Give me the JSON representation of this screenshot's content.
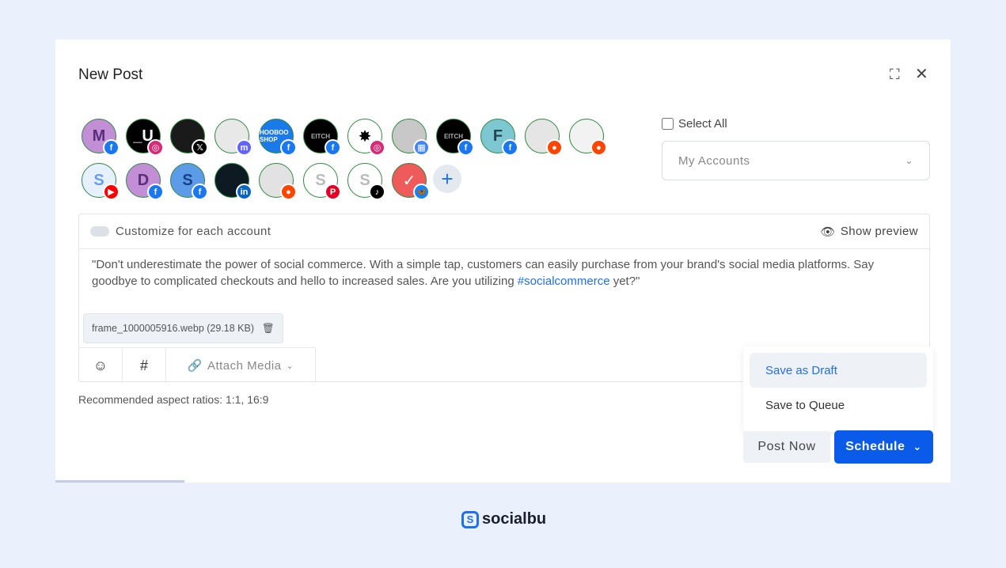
{
  "modal": {
    "title": "New Post"
  },
  "accounts": [
    {
      "label": "M",
      "bg": "#c28fd6",
      "fg": "#5a2e7a",
      "network": "facebook"
    },
    {
      "label": "_U",
      "bg": "#000000",
      "fg": "#ffffff",
      "network": "instagram"
    },
    {
      "label": "",
      "bg": "#1a1a1a",
      "fg": "#fff",
      "network": "x"
    },
    {
      "label": "",
      "bg": "#e8e8e8",
      "fg": "#333",
      "network": "mastodon"
    },
    {
      "label": "HOOBOO SHOP",
      "bg": "#1a7ae8",
      "fg": "#ffffff",
      "network": "facebook"
    },
    {
      "label": "EITCH",
      "bg": "#000000",
      "fg": "#aaaaaa",
      "network": "facebook"
    },
    {
      "label": "✸",
      "bg": "#ffffff",
      "fg": "#000",
      "network": "instagram"
    },
    {
      "label": "",
      "bg": "#c8c8c8",
      "fg": "#fff",
      "network": "google-business"
    },
    {
      "label": "EITCH",
      "bg": "#000000",
      "fg": "#aaaaaa",
      "network": "facebook"
    },
    {
      "label": "F",
      "bg": "#7cc7d1",
      "fg": "#245",
      "network": "facebook"
    },
    {
      "label": "",
      "bg": "#e5e5e5",
      "fg": "#fff",
      "network": "reddit"
    },
    {
      "label": "",
      "bg": "#f2f2f2",
      "fg": "#999",
      "network": "reddit"
    },
    {
      "label": "S",
      "bg": "#e6f0ff",
      "fg": "#6a9cf0",
      "network": "youtube"
    },
    {
      "label": "D",
      "bg": "#c28fd6",
      "fg": "#5a2e7a",
      "network": "facebook"
    },
    {
      "label": "S",
      "bg": "#5b9be8",
      "fg": "#1a3f8a",
      "network": "facebook"
    },
    {
      "label": "",
      "bg": "#0d1a22",
      "fg": "#fff",
      "network": "linkedin"
    },
    {
      "label": "",
      "bg": "#e2e2e2",
      "fg": "#fff",
      "network": "reddit"
    },
    {
      "label": "S",
      "bg": "#ffffff",
      "fg": "#bbbbbb",
      "network": "pinterest"
    },
    {
      "label": "S",
      "bg": "#ffffff",
      "fg": "#bbbbbb",
      "network": "tiktok"
    },
    {
      "label": "✓",
      "bg": "#ef5a5a",
      "fg": "#ffffff",
      "network": "bluesky"
    }
  ],
  "networks": {
    "facebook": {
      "glyph": "f",
      "color": "#1877f2"
    },
    "instagram": {
      "glyph": "◎",
      "color": "#d62976"
    },
    "x": {
      "glyph": "𝕏",
      "color": "#000000"
    },
    "mastodon": {
      "glyph": "m",
      "color": "#6364ff"
    },
    "google-business": {
      "glyph": "▦",
      "color": "#4285f4"
    },
    "reddit": {
      "glyph": "●",
      "color": "#ff4500"
    },
    "youtube": {
      "glyph": "▶",
      "color": "#ff0000"
    },
    "linkedin": {
      "glyph": "in",
      "color": "#0a66c2"
    },
    "pinterest": {
      "glyph": "P",
      "color": "#e60023"
    },
    "tiktok": {
      "glyph": "♪",
      "color": "#000000"
    },
    "bluesky": {
      "glyph": "🦋",
      "color": "#1185fe"
    }
  },
  "select_all": {
    "label": "Select All",
    "checked": false
  },
  "account_dropdown": {
    "value": "My Accounts"
  },
  "editor": {
    "customize_label": "Customize for each account",
    "customize_on": false,
    "preview_label": "Show preview",
    "text_before": "\"Don't underestimate the power of social commerce. With a simple tap, customers can easily purchase from your brand's social media platforms. Say goodbye to complicated checkouts and hello to increased sales. Are you utilizing ",
    "hashtag": "#socialcommerce",
    "text_after": " yet?\"",
    "attachment": "frame_1000005916.webp (29.18 KB)",
    "attach_media_label": "Attach Media"
  },
  "recommended": "Recommended aspect ratios: 1:1, 16:9",
  "menu": {
    "items": [
      "Save as Draft",
      "Save to Queue"
    ],
    "hovered": "Save as Draft"
  },
  "buttons": {
    "post_now": "Post Now",
    "schedule": "Schedule"
  },
  "brand": {
    "name": "socialbu",
    "accent": "#1f6ff0"
  }
}
